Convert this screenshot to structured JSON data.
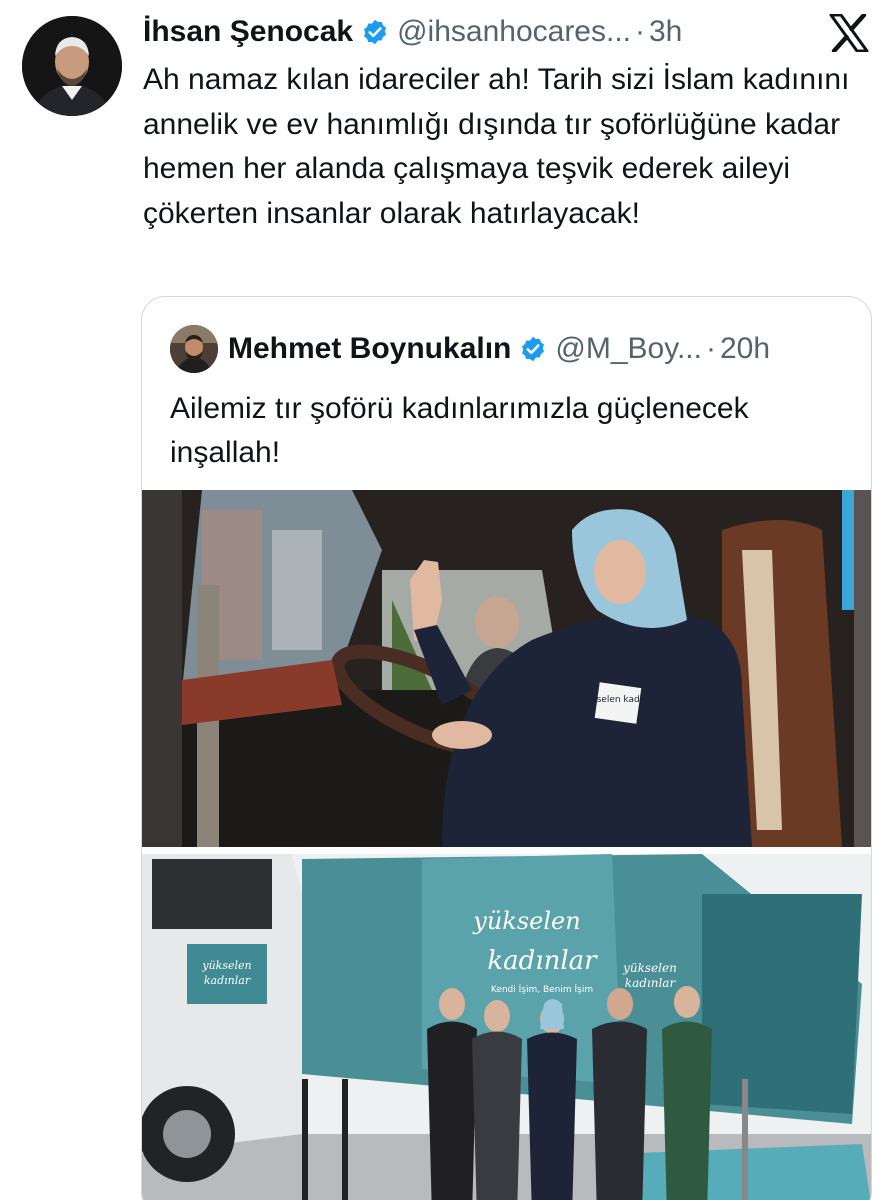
{
  "tweet": {
    "author_name": "İhsan Şenocak",
    "handle": "@ihsanhocares...",
    "separator": "·",
    "time": "3h",
    "text": "Ah namaz kılan idareciler ah! Tarih sizi İslam kadınını annelik ve ev hanımlığı dışında tır şoförlüğüne kadar hemen her alanda çalışmaya teşvik ederek aileyi çökerten insanlar olarak hatırlayacak!"
  },
  "quoted_tweet": {
    "author_name": "Mehmet Boynukalın",
    "handle": "@M_Boy...",
    "separator": "·",
    "time": "20h",
    "text": "Ailemiz tır şoförü kadınlarımızla güçlenecek inşallah!"
  },
  "photo_text": {
    "jacket_patch": "yükselen kadınlar",
    "banner_main_line1": "yükselen",
    "banner_main_line2": "kadınlar",
    "banner_main_tagline": "Kendi İşim, Benim İşim",
    "banner_side_line1": "yükselen",
    "banner_side_line2": "kadınlar",
    "cab_sign_line1": "yükselen",
    "cab_sign_line2": "kadınlar"
  },
  "icons": {
    "verified": "verified-badge-icon",
    "platform": "x-logo-icon"
  },
  "colors": {
    "verified_blue": "#1d9bf0",
    "text_primary": "#0f1419",
    "text_secondary": "#536471",
    "border": "#cfd9de",
    "truck_teal": "#4a8f96"
  }
}
